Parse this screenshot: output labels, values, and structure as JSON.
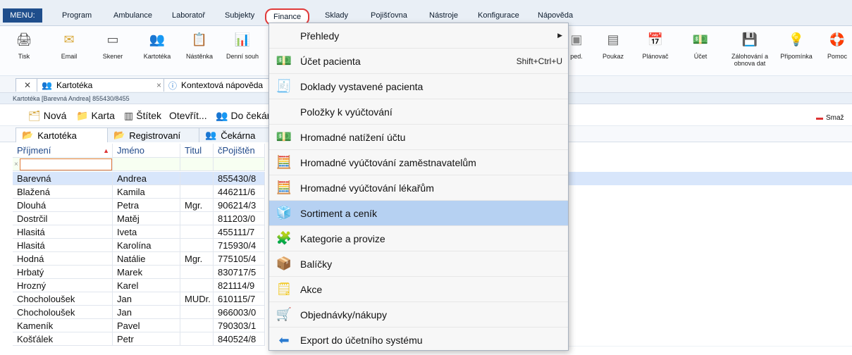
{
  "menubar": {
    "menu_label": "MENU:",
    "items": [
      "Program",
      "Ambulance",
      "Laboratoř",
      "Subjekty",
      "Finance",
      "Sklady",
      "Pojišťovna",
      "Nástroje",
      "Konfigurace",
      "Nápověda"
    ]
  },
  "toolbar": {
    "items": [
      "Tisk",
      "Email",
      "Skener",
      "Kartotéka",
      "Nástěnka",
      "Denní souh",
      "ped.",
      "Poukaz",
      "Plánovač",
      "Účet",
      "Zálohování a obnova dat",
      "Připomínka",
      "Pomoc"
    ]
  },
  "tabs": {
    "kartoteka": "Kartotéka",
    "help": "Kontextová nápověda"
  },
  "breadcrumb": "Kartotéka [Barevná Andrea] 855430/8455",
  "actions": {
    "new": "Nová",
    "karta": "Karta",
    "stitek": "Štítek",
    "otevrit": "Otevřít...",
    "cekarna": "Do čekár",
    "delete": "Smaž"
  },
  "inner_tabs": [
    "Kartotéka",
    "Registrovaní",
    "Čekárna"
  ],
  "grid": {
    "headers": [
      "Příjmení",
      "Jméno",
      "Titul",
      "čPojištěn"
    ],
    "rows": [
      [
        "Barevná",
        "Andrea",
        "",
        "855430/8"
      ],
      [
        "Blažená",
        "Kamila",
        "",
        "446211/6"
      ],
      [
        "Dlouhá",
        "Petra",
        "Mgr.",
        "906214/3"
      ],
      [
        "Dostrčil",
        "Matěj",
        "",
        "811203/0"
      ],
      [
        "Hlasitá",
        "Iveta",
        "",
        "455111/7"
      ],
      [
        "Hlasitá",
        "Karolína",
        "",
        "715930/4"
      ],
      [
        "Hodná",
        "Natálie",
        "Mgr.",
        "775105/4"
      ],
      [
        "Hrbatý",
        "Marek",
        "",
        "830717/5"
      ],
      [
        "Hrozný",
        "Karel",
        "",
        "821114/9"
      ],
      [
        "Chocholoušek",
        "Jan",
        "MUDr.",
        "610115/7"
      ],
      [
        "Chocholoušek",
        "Jan",
        "",
        "966003/0"
      ],
      [
        "Kameník",
        "Pavel",
        "",
        "790303/1"
      ],
      [
        "Košťálek",
        "Petr",
        "",
        "840524/8"
      ]
    ]
  },
  "finance_menu": [
    {
      "label": "Přehledy",
      "shortcut": "",
      "submenu": true
    },
    {
      "label": "Účet pacienta",
      "shortcut": "Shift+Ctrl+U"
    },
    {
      "label": "Doklady vystavené pacienta",
      "shortcut": ""
    },
    {
      "label": "Položky k vyúčtování",
      "shortcut": ""
    },
    {
      "label": "Hromadné natížení účtu",
      "shortcut": ""
    },
    {
      "label": "Hromadné vyúčtování zaměstnavatelům",
      "shortcut": ""
    },
    {
      "label": "Hromadné vyúčtování lékařům",
      "shortcut": ""
    },
    {
      "label": "Sortiment a ceník",
      "shortcut": "",
      "highlighted": true
    },
    {
      "label": "Kategorie a provize",
      "shortcut": ""
    },
    {
      "label": "Balíčky",
      "shortcut": ""
    },
    {
      "label": "Akce",
      "shortcut": ""
    },
    {
      "label": "Objednávky/nákupy",
      "shortcut": ""
    },
    {
      "label": "Export do účetního systému",
      "shortcut": ""
    }
  ],
  "colors": {
    "accent": "#1f4e8c",
    "highlight": "#b6d1f2",
    "finance_circle": "#e03a3a"
  }
}
